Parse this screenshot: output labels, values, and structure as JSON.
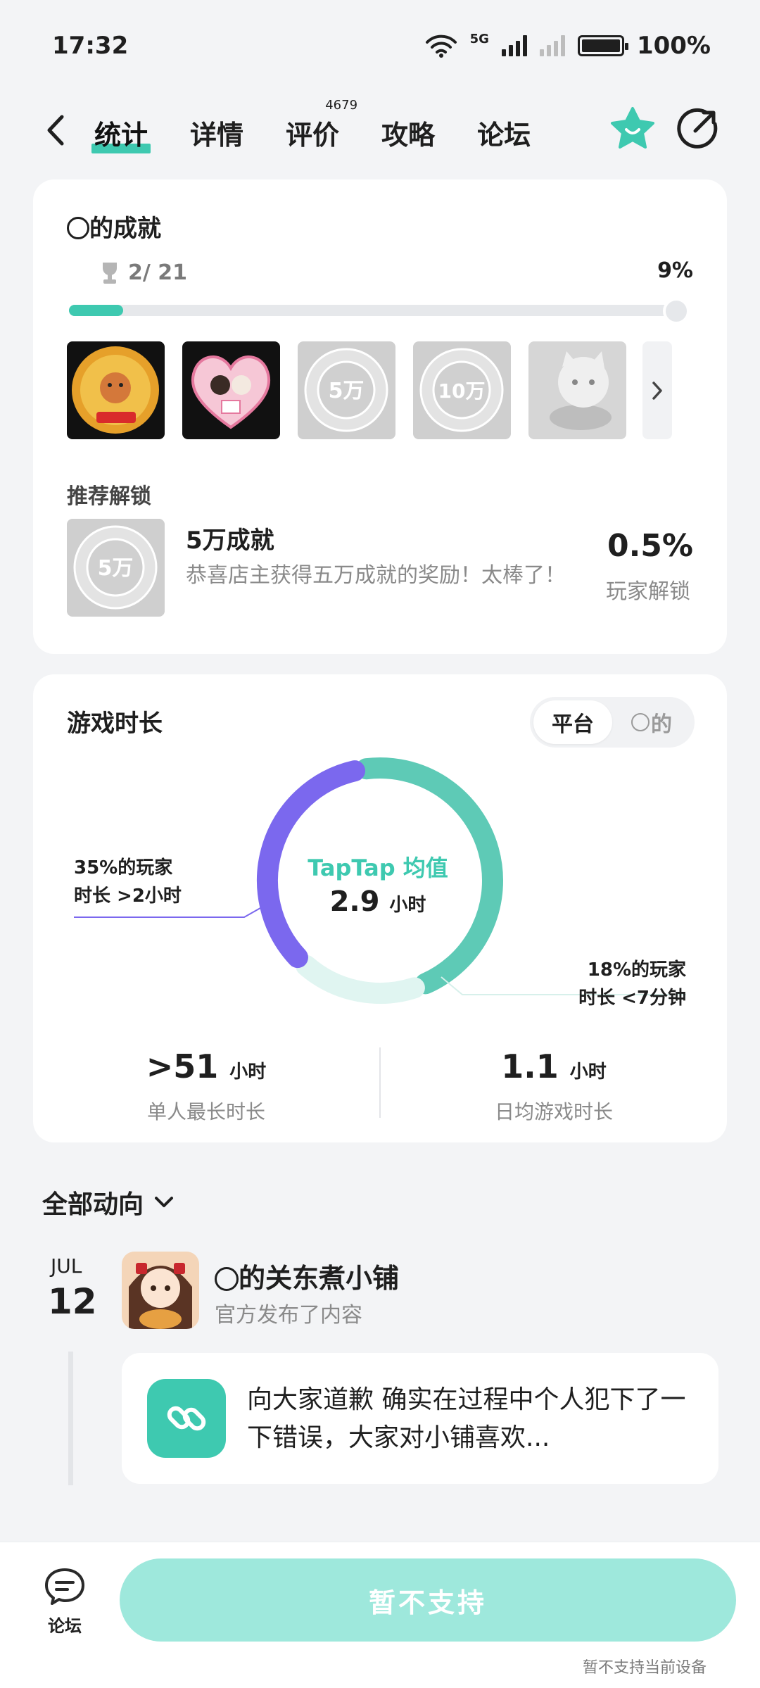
{
  "status_bar": {
    "time": "17:32",
    "network": "5G",
    "battery": "100%"
  },
  "nav": {
    "tabs": [
      {
        "label": "统计",
        "active": true
      },
      {
        "label": "详情",
        "active": false
      },
      {
        "label": "评价",
        "badge": "4679",
        "active": false
      },
      {
        "label": "攻略",
        "active": false
      },
      {
        "label": "论坛",
        "active": false
      }
    ],
    "icons": [
      "back-icon",
      "star-icon",
      "share-icon"
    ]
  },
  "achievements": {
    "title": "的成就",
    "progress_text": "2/ 21",
    "progress_percent": "9%",
    "progress_fraction": 0.09,
    "badges": [
      {
        "name": "店主 BOSS badge",
        "unlocked": true
      },
      {
        "name": "wedding badge",
        "unlocked": true
      },
      {
        "name": "5万",
        "unlocked": false
      },
      {
        "name": "10万",
        "unlocked": false
      },
      {
        "name": "cat badge",
        "unlocked": false
      }
    ],
    "recommend_title": "推荐解锁",
    "recommend": {
      "name": "5万成就",
      "description": "恭喜店主获得五万成就的奖励！太棒了！",
      "rate": "0.5%",
      "rate_label": "玩家解锁"
    }
  },
  "playtime": {
    "title": "游戏时长",
    "toggle": [
      "平台",
      "的"
    ],
    "toggle_selected": "平台",
    "center_brand": "TapTap 均值",
    "center_value": "2.9",
    "center_unit": "小时",
    "callout_left": [
      "35%的玩家",
      "时长 >2小时"
    ],
    "callout_right": [
      "18%的玩家",
      "时长 <7分钟"
    ],
    "segments": [
      {
        "name": "long",
        "percent": 35,
        "color": "#7b68ee"
      },
      {
        "name": "mid",
        "percent": 47,
        "color": "#5ecab6"
      },
      {
        "name": "short",
        "percent": 18,
        "color": "#e0f5f1"
      }
    ],
    "stats": [
      {
        "value": ">51",
        "unit": "小时",
        "label": "单人最长时长"
      },
      {
        "value": "1.1",
        "unit": "小时",
        "label": "日均游戏时长"
      }
    ]
  },
  "feed": {
    "filter_label": "全部动向",
    "month": "JUL",
    "day": "12",
    "author": "的关东煮小铺",
    "action": "官方发布了内容",
    "post_text": "向大家道歉 确实在过程中个人犯下了一下错误，大家对小铺喜欢..."
  },
  "bottom": {
    "forum_label": "论坛",
    "support_label": "暂不支持",
    "support_note": "暂不支持当前设备"
  },
  "colors": {
    "accent": "#3ec9b0",
    "purple": "#7b68ee",
    "button_disabled": "#9ee8dc"
  }
}
